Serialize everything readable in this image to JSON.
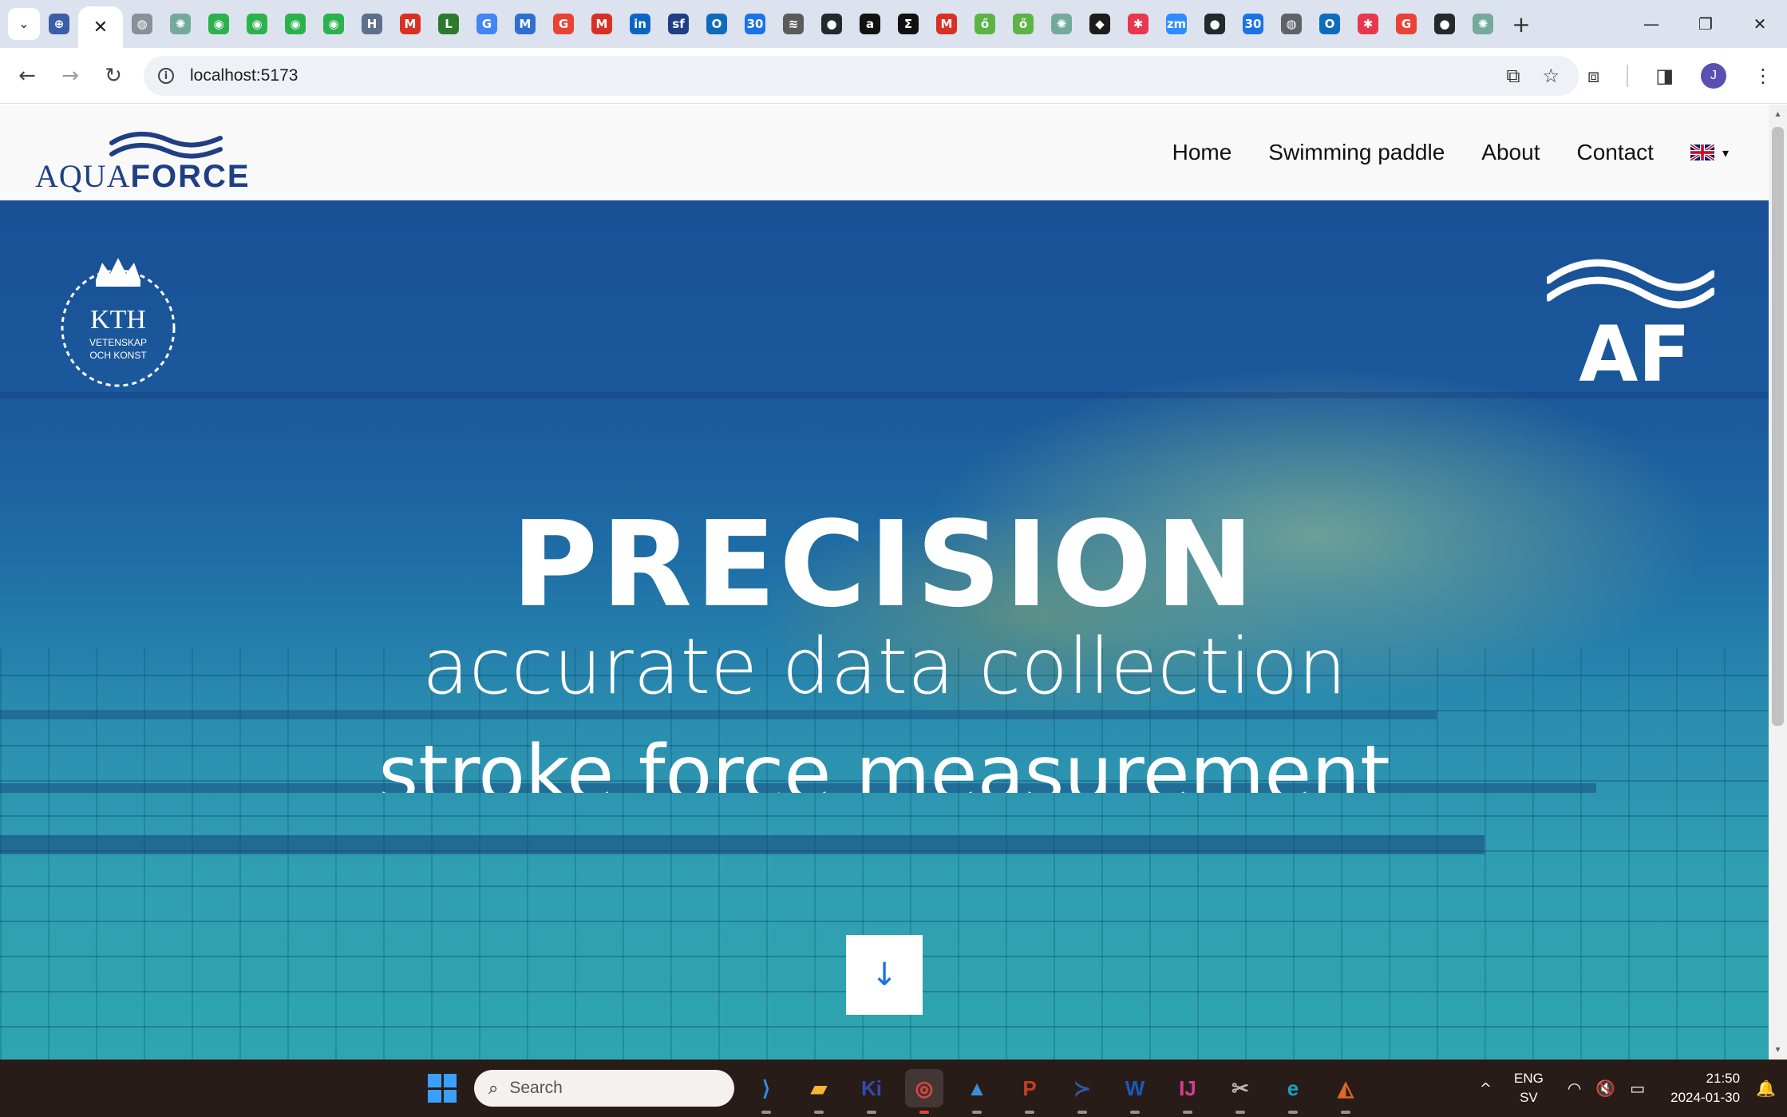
{
  "browser": {
    "tabs": [
      {
        "icon": "ai-hub-icon",
        "color": "#3b5fa6",
        "glyph": "⊕"
      },
      {
        "icon": "close-icon",
        "active": true,
        "glyph": "✕"
      },
      {
        "icon": "globe-icon",
        "color": "#8a8f98",
        "glyph": "◍"
      },
      {
        "icon": "chatgpt-icon",
        "color": "#74aa9c",
        "glyph": "✺"
      },
      {
        "icon": "kahoot-green-icon",
        "color": "#2bb24c",
        "glyph": "◉"
      },
      {
        "icon": "kahoot-green-icon",
        "color": "#2bb24c",
        "glyph": "◉"
      },
      {
        "icon": "kahoot-green-icon",
        "color": "#2bb24c",
        "glyph": "◉"
      },
      {
        "icon": "kahoot-green-icon",
        "color": "#2bb24c",
        "glyph": "◉"
      },
      {
        "icon": "hyundai-icon",
        "color": "#5d6f8a",
        "glyph": "H"
      },
      {
        "icon": "gmail-icon",
        "color": "#d93025",
        "glyph": "M"
      },
      {
        "icon": "l-icon",
        "color": "#2d7a2d",
        "glyph": "L"
      },
      {
        "icon": "translate-icon",
        "color": "#4285f4",
        "glyph": "G"
      },
      {
        "icon": "ms-icon",
        "color": "#2f6fcf",
        "glyph": "M"
      },
      {
        "icon": "google-icon",
        "color": "#ea4335",
        "glyph": "G"
      },
      {
        "icon": "gmail-icon",
        "color": "#d93025",
        "glyph": "M"
      },
      {
        "icon": "linkedin-icon",
        "color": "#0a66c2",
        "glyph": "in"
      },
      {
        "icon": "sf-icon",
        "color": "#1f3f84",
        "glyph": "sf"
      },
      {
        "icon": "outlook-icon",
        "color": "#0f6cbd",
        "glyph": "O"
      },
      {
        "icon": "calendar-icon",
        "color": "#1a73e8",
        "glyph": "30"
      },
      {
        "icon": "stack-icon",
        "color": "#5b5b5b",
        "glyph": "≋"
      },
      {
        "icon": "github-icon",
        "color": "#24292e",
        "glyph": "●"
      },
      {
        "icon": "amazon-icon",
        "color": "#111111",
        "glyph": "a"
      },
      {
        "icon": "sigma-icon",
        "color": "#111111",
        "glyph": "Σ"
      },
      {
        "icon": "gmail-icon",
        "color": "#d93025",
        "glyph": "M"
      },
      {
        "icon": "sprout-icon",
        "color": "#5bb443",
        "glyph": "ő"
      },
      {
        "icon": "sprout-icon",
        "color": "#5bb443",
        "glyph": "ő"
      },
      {
        "icon": "chatgpt-icon",
        "color": "#74aa9c",
        "glyph": "✺"
      },
      {
        "icon": "cube-icon",
        "color": "#1c1c1c",
        "glyph": "◆"
      },
      {
        "icon": "asana-icon",
        "color": "#e8384f",
        "glyph": "✱"
      },
      {
        "icon": "zoom-icon",
        "color": "#2d8cff",
        "glyph": "zm"
      },
      {
        "icon": "github-icon",
        "color": "#24292e",
        "glyph": "●"
      },
      {
        "icon": "calendar-icon",
        "color": "#1a73e8",
        "glyph": "30"
      },
      {
        "icon": "globe-icon",
        "color": "#5f6368",
        "glyph": "◍"
      },
      {
        "icon": "outlook-icon",
        "color": "#0f6cbd",
        "glyph": "O"
      },
      {
        "icon": "asana-icon",
        "color": "#e8384f",
        "glyph": "✱"
      },
      {
        "icon": "google-icon",
        "color": "#ea4335",
        "glyph": "G"
      },
      {
        "icon": "github-icon",
        "color": "#24292e",
        "glyph": "●"
      },
      {
        "icon": "chatgpt-icon",
        "color": "#74aa9c",
        "glyph": "✺"
      }
    ],
    "new_tab_glyph": "+",
    "window_controls": {
      "minimize": "—",
      "restore": "❐",
      "close": "✕"
    },
    "back_glyph": "←",
    "forward_glyph": "→",
    "reload_glyph": "↻",
    "url": "localhost:5173",
    "info_glyph": "i",
    "translate_glyph": "⧉",
    "star_glyph": "☆",
    "extensions_glyph": "⧈",
    "sidepanel_glyph": "◨",
    "profile_initial": "J",
    "menu_glyph": "⋮",
    "tab_menu_glyph": "⌄"
  },
  "site": {
    "logo": {
      "aqua": "AQUA",
      "force": "FORCE"
    },
    "nav": {
      "home": "Home",
      "swimming_paddle": "Swimming paddle",
      "about": "About",
      "contact": "Contact"
    },
    "lang_caret": "▾",
    "kth": {
      "name": "KTH",
      "line1": "VETENSKAP",
      "line2": "OCH KONST"
    },
    "af": "AF",
    "hero": {
      "title": "PRECISION",
      "line2": "accurate data collection",
      "line3": "stroke force measurement"
    },
    "scroll_glyph": "↓"
  },
  "taskbar": {
    "search_label": "Search",
    "search_glyph": "⌕",
    "apps": [
      {
        "name": "vscode-icon",
        "color": "#2a8ee6",
        "glyph": "⟩"
      },
      {
        "name": "file-explorer-icon",
        "color": "#f2b632",
        "glyph": "▰"
      },
      {
        "name": "kicad-icon",
        "color": "#314cb0",
        "glyph": "Ki"
      },
      {
        "name": "chrome-icon",
        "color": "#e2453c",
        "glyph": "◎",
        "active": true
      },
      {
        "name": "photos-icon",
        "color": "#3b8ed6",
        "glyph": "▲"
      },
      {
        "name": "powerpoint-icon",
        "color": "#c4401d",
        "glyph": "P"
      },
      {
        "name": "powershell-icon",
        "color": "#2c5aa0",
        "glyph": "≻"
      },
      {
        "name": "word-icon",
        "color": "#185abd",
        "glyph": "W"
      },
      {
        "name": "intellij-icon",
        "color": "#d43f8d",
        "glyph": "IJ"
      },
      {
        "name": "snipping-icon",
        "color": "#b8b8b8",
        "glyph": "✂"
      },
      {
        "name": "edge-icon",
        "color": "#1aa0c4",
        "glyph": "e"
      },
      {
        "name": "matlab-icon",
        "color": "#e0662a",
        "glyph": "◭"
      }
    ],
    "tray": {
      "chevron": "^",
      "lang_top": "ENG",
      "lang_bottom": "SV",
      "wifi": "◠",
      "volume": "🔇",
      "battery": "▭",
      "time": "21:50",
      "date": "2024-01-30",
      "bell": "🔔"
    }
  },
  "colors": {
    "brand_navy": "#1f3f84",
    "header_bg": "#f9f9f9",
    "taskbar_bg": "#281c18",
    "tabstrip_bg": "#dde3ee",
    "accent_blue": "#1a73e8"
  }
}
